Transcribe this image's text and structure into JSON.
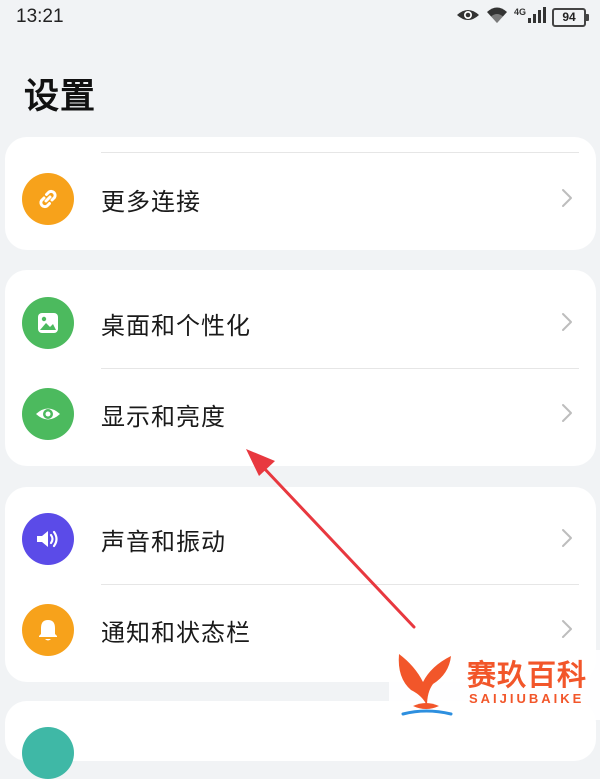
{
  "status_bar": {
    "time": "13:21",
    "network": "4G",
    "battery": "94",
    "icons": [
      "eye-icon",
      "wifi-icon",
      "signal-icon",
      "battery-icon"
    ]
  },
  "page": {
    "title": "设置"
  },
  "groups": [
    {
      "items": [
        {
          "label": "更多连接",
          "icon": "link-icon",
          "color": "#f7a21b"
        }
      ]
    },
    {
      "items": [
        {
          "label": "桌面和个性化",
          "icon": "image-icon",
          "color": "#4cba5e"
        },
        {
          "label": "显示和亮度",
          "icon": "eye-icon",
          "color": "#4cba5e"
        }
      ]
    },
    {
      "items": [
        {
          "label": "声音和振动",
          "icon": "speaker-icon",
          "color": "#5b4be8"
        },
        {
          "label": "通知和状态栏",
          "icon": "bell-icon",
          "color": "#f7a21b"
        }
      ]
    }
  ],
  "annotation": {
    "color": "#e8383f"
  },
  "watermark": {
    "cn": "赛玖百科",
    "en": "SAIJIUBAIKE",
    "color": "#f2562a"
  }
}
